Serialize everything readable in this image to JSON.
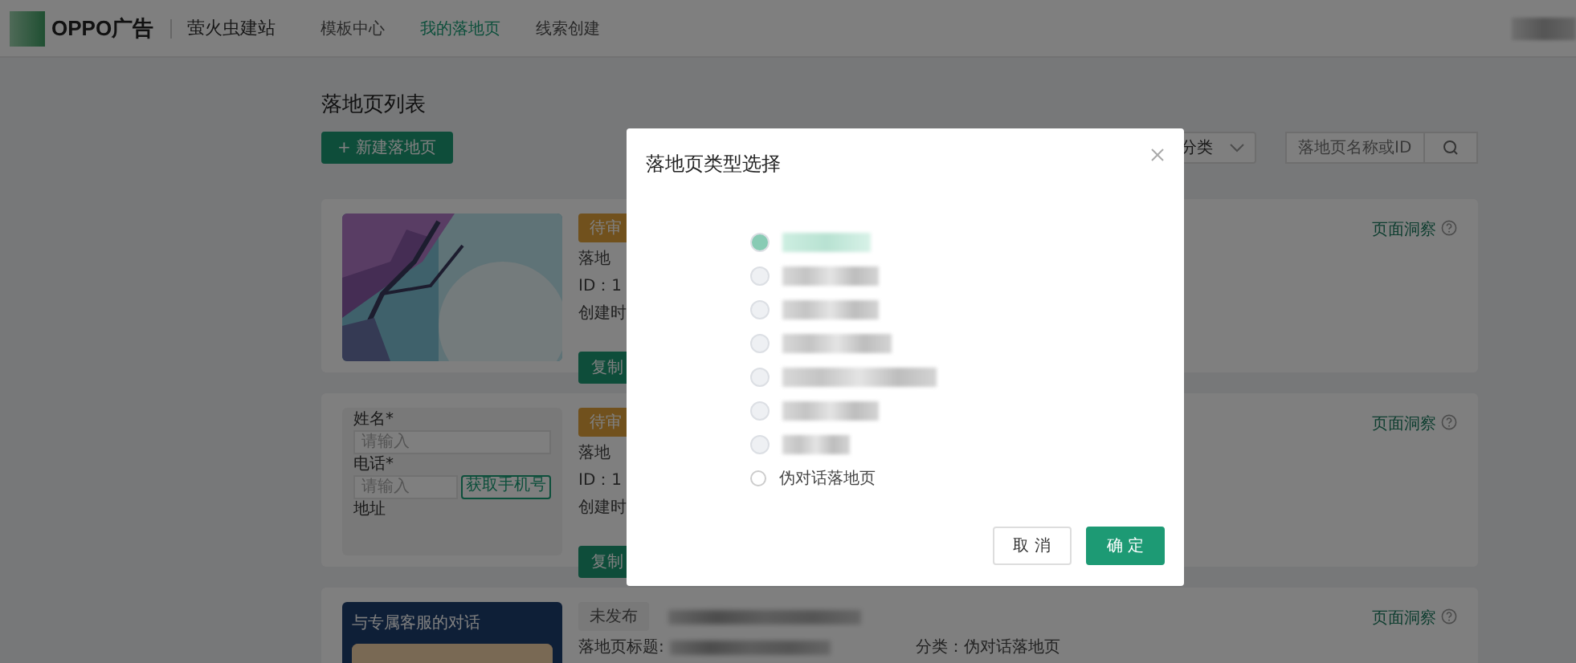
{
  "header": {
    "brand": "OPPO广告",
    "product": "萤火虫建站",
    "nav": [
      {
        "label": "模板中心",
        "selected": false
      },
      {
        "label": "我的落地页",
        "selected": true
      },
      {
        "label": "线索创建",
        "selected": false
      }
    ]
  },
  "page": {
    "title": "落地页列表",
    "new_button": "+ 新建落地页",
    "category_select": "分类",
    "search": {
      "placeholder": "落地页名称或ID"
    }
  },
  "cards": [
    {
      "status": "待审",
      "color": "#71511d",
      "title_label": "落地",
      "id": "ID：1",
      "created": "创建时",
      "action": "复制",
      "insight": "页面洞察"
    },
    {
      "kind": "form",
      "form": {
        "name_label": "姓名*",
        "name_placeholder": "请输入",
        "phone_label": "电话*",
        "phone_placeholder": "请输入",
        "phone_button": "获取手机号",
        "address_label": "地址"
      },
      "status": "待审",
      "color": "#71511d",
      "title_label": "落地",
      "id": "ID：1",
      "created": "创建时",
      "action": "复制",
      "insight": "页面洞察"
    },
    {
      "kind": "chat",
      "chat_title": "与专属客服的对话",
      "status": "未发布",
      "color": "#797979",
      "title_label": "落地页标题:",
      "category": "分类：伪对话落地页",
      "insight": "页面洞察"
    }
  ],
  "dialog": {
    "title": "落地页类型选择",
    "options": [
      {
        "kind": "redacted",
        "selected": true
      },
      {
        "kind": "redacted",
        "selected": false
      },
      {
        "kind": "redacted",
        "selected": false
      },
      {
        "kind": "redacted",
        "selected": false
      },
      {
        "kind": "redacted",
        "selected": false
      },
      {
        "kind": "redacted",
        "selected": false
      },
      {
        "kind": "redacted",
        "selected": false
      },
      {
        "kind": "text",
        "label": "伪对话落地页",
        "selected": false
      }
    ],
    "buttons": [
      {
        "label": "取 消",
        "kind": "secondary"
      },
      {
        "label": "确 定",
        "kind": "primary"
      }
    ]
  }
}
